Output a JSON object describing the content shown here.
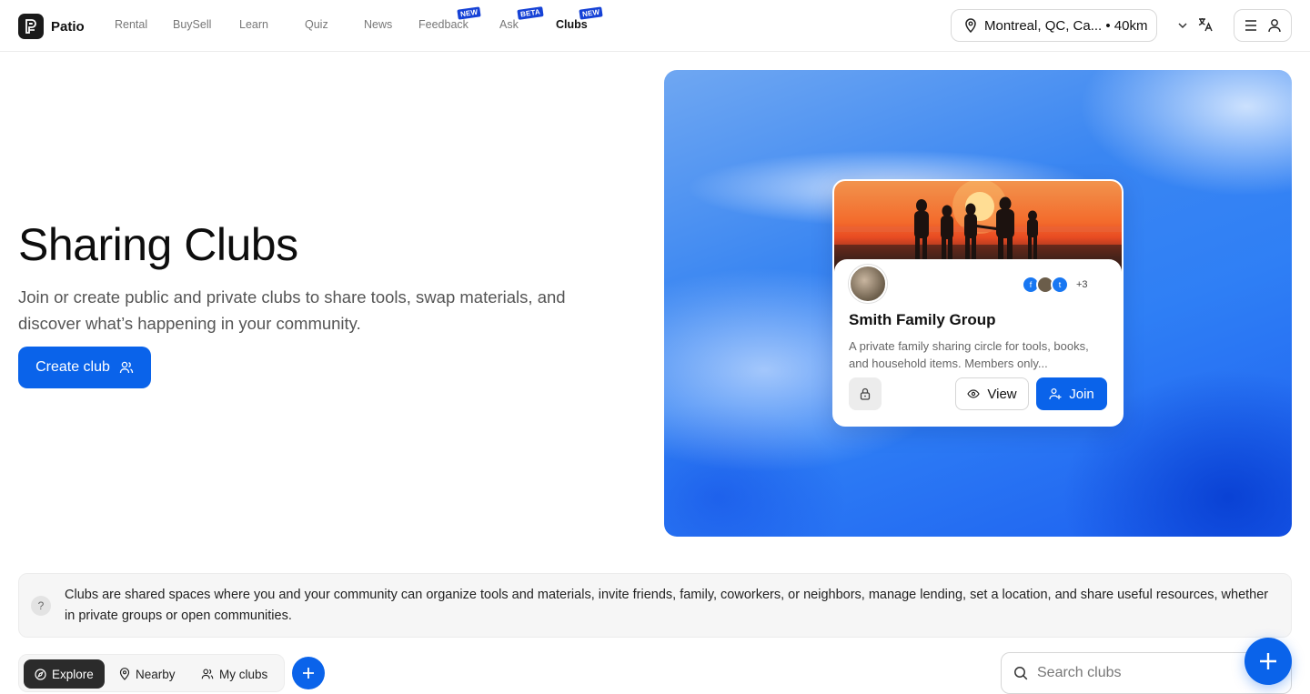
{
  "app": {
    "name": "Patio"
  },
  "nav": {
    "items": [
      {
        "label": "Rental",
        "badge": ""
      },
      {
        "label": "BuySell",
        "badge": ""
      },
      {
        "label": "Learn",
        "badge": ""
      },
      {
        "label": "Quiz",
        "badge": ""
      },
      {
        "label": "News",
        "badge": ""
      },
      {
        "label": "Feedback",
        "badge": "NEW"
      },
      {
        "label": "Ask",
        "badge": "BETA"
      },
      {
        "label": "Clubs",
        "badge": "NEW",
        "active": true
      }
    ],
    "location": "Montreal, QC, Ca... • 40km",
    "icons": [
      "map-pin-icon",
      "chevron-down-icon",
      "translate-icon",
      "menu-icon",
      "user-icon"
    ]
  },
  "hero": {
    "title": "Sharing Clubs",
    "subtitle": "Join or create public and private clubs to share tools, swap materials, and discover what’s happening in your community.",
    "create_button": "Create club"
  },
  "club_card": {
    "name": "Smith Family Group",
    "description": "A private family sharing circle for tools, books, and household items. Members only...",
    "member_initials": [
      "f",
      "",
      "t"
    ],
    "member_more": "+3",
    "view_label": "View",
    "join_label": "Join",
    "privacy": "lock-icon"
  },
  "info": {
    "icon": "?",
    "text": "Clubs are shared spaces where you and your community can organize tools and materials, invite friends, family, coworkers, or neighbors, manage lending, set a location, and share useful resources, whether in private groups or open communities."
  },
  "tabs": {
    "items": [
      {
        "label": "Explore",
        "active": true
      },
      {
        "label": "Nearby",
        "active": false
      },
      {
        "label": "My clubs",
        "active": false
      }
    ]
  },
  "search": {
    "placeholder": "Search clubs"
  },
  "colors": {
    "accent": "#0a63ea",
    "badge": "#1642d6",
    "dark": "#2b2b2b"
  }
}
